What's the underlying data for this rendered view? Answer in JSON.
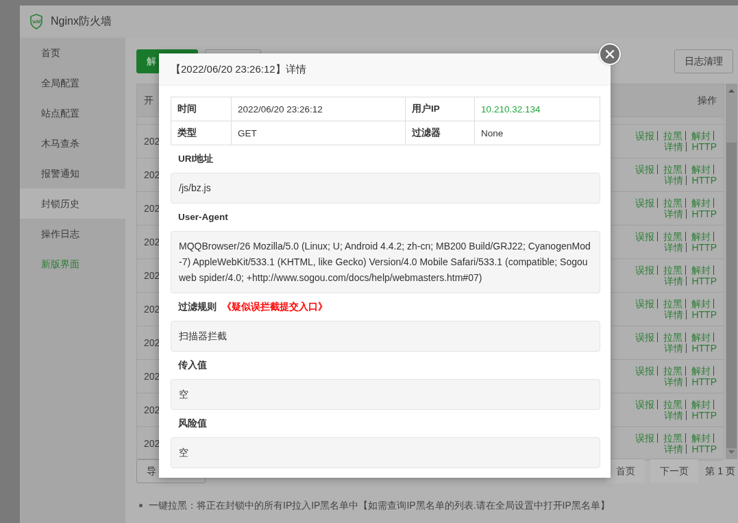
{
  "app": {
    "title": "Nginx防火墙"
  },
  "sidebar": {
    "items": [
      {
        "label": "首页",
        "selected": false,
        "kind": "nav"
      },
      {
        "label": "全局配置",
        "selected": false,
        "kind": "nav"
      },
      {
        "label": "站点配置",
        "selected": false,
        "kind": "nav"
      },
      {
        "label": "木马查杀",
        "selected": false,
        "kind": "nav"
      },
      {
        "label": "报警通知",
        "selected": false,
        "kind": "nav"
      },
      {
        "label": "封锁历史",
        "selected": true,
        "kind": "nav"
      },
      {
        "label": "操作日志",
        "selected": false,
        "kind": "nav"
      },
      {
        "label": "新版界面",
        "selected": false,
        "kind": "link"
      }
    ]
  },
  "toolbar": {
    "left_buttons": [
      {
        "label": "解",
        "kind": "primary"
      },
      {
        "kind": "default"
      }
    ],
    "right_buttons": [
      {
        "label": "日志清理",
        "kind": "default"
      }
    ]
  },
  "table": {
    "columns": [
      {
        "label": "开"
      },
      {
        "label": "操作"
      }
    ],
    "rows": [
      {
        "column_1": "202",
        "actions": [
          "误报",
          "拉黑",
          "解封",
          "详情",
          "HTTP"
        ]
      },
      {
        "column_1": "202",
        "actions": [
          "误报",
          "拉黑",
          "解封",
          "详情",
          "HTTP"
        ]
      },
      {
        "column_1": "202",
        "actions": [
          "误报",
          "拉黑",
          "解封",
          "详情",
          "HTTP"
        ]
      },
      {
        "column_1": "202",
        "actions": [
          "误报",
          "拉黑",
          "解封",
          "详情",
          "HTTP"
        ]
      },
      {
        "column_1": "202",
        "actions": [
          "误报",
          "拉黑",
          "解封",
          "详情",
          "HTTP"
        ]
      },
      {
        "column_1": "202",
        "actions": [
          "误报",
          "拉黑",
          "解封",
          "详情",
          "HTTP"
        ]
      },
      {
        "column_1": "202",
        "actions": [
          "误报",
          "拉黑",
          "解封",
          "详情",
          "HTTP"
        ]
      },
      {
        "column_1": "202",
        "actions": [
          "误报",
          "拉黑",
          "解封",
          "详情",
          "HTTP"
        ]
      },
      {
        "column_1": "202",
        "actions": [
          "误报",
          "拉黑",
          "解封",
          "详情",
          "HTTP"
        ]
      },
      {
        "column_1": "202",
        "actions": [
          "误报",
          "拉黑",
          "解封",
          "详情",
          "HTTP"
        ]
      }
    ]
  },
  "pagination": {
    "export_label": "导",
    "buttons": [
      "首页",
      "下一页"
    ],
    "page_info": "第 1 页"
  },
  "notes": [
    "一键拉黑：将正在封锁中的所有IP拉入IP黑名单中【如需查询IP黑名单的列表.请在全局设置中打开IP黑名单】"
  ],
  "dialog": {
    "title": "【2022/06/20 23:26:12】详情",
    "info": [
      [
        {
          "label": "时间",
          "value": "2022/06/20 23:26:12",
          "kind": "plain"
        },
        {
          "label": "用户IP",
          "value": "10.210.32.134",
          "kind": "ip"
        }
      ],
      [
        {
          "label": "类型",
          "value": "GET",
          "kind": "plain"
        },
        {
          "label": "过滤器",
          "value": "None",
          "kind": "plain"
        }
      ]
    ],
    "sections": [
      {
        "label": "URI地址",
        "value": "/js/bz.js"
      },
      {
        "label": "User-Agent",
        "value": "MQQBrowser/26 Mozilla/5.0 (Linux; U; Android 4.4.2; zh-cn; MB200 Build/GRJ22; CyanogenMod-7) AppleWebKit/533.1 (KHTML, like Gecko) Version/4.0 Mobile Safari/533.1 (compatible; Sogou web spider/4.0; +http://www.sogou.com/docs/help/webmasters.htm#07)"
      },
      {
        "label": "过滤规则",
        "link": "《疑似误拦截提交入口》",
        "value": "扫描器拦截"
      },
      {
        "label": "传入值",
        "value": "空"
      },
      {
        "label": "风险值",
        "value": "空"
      }
    ]
  }
}
